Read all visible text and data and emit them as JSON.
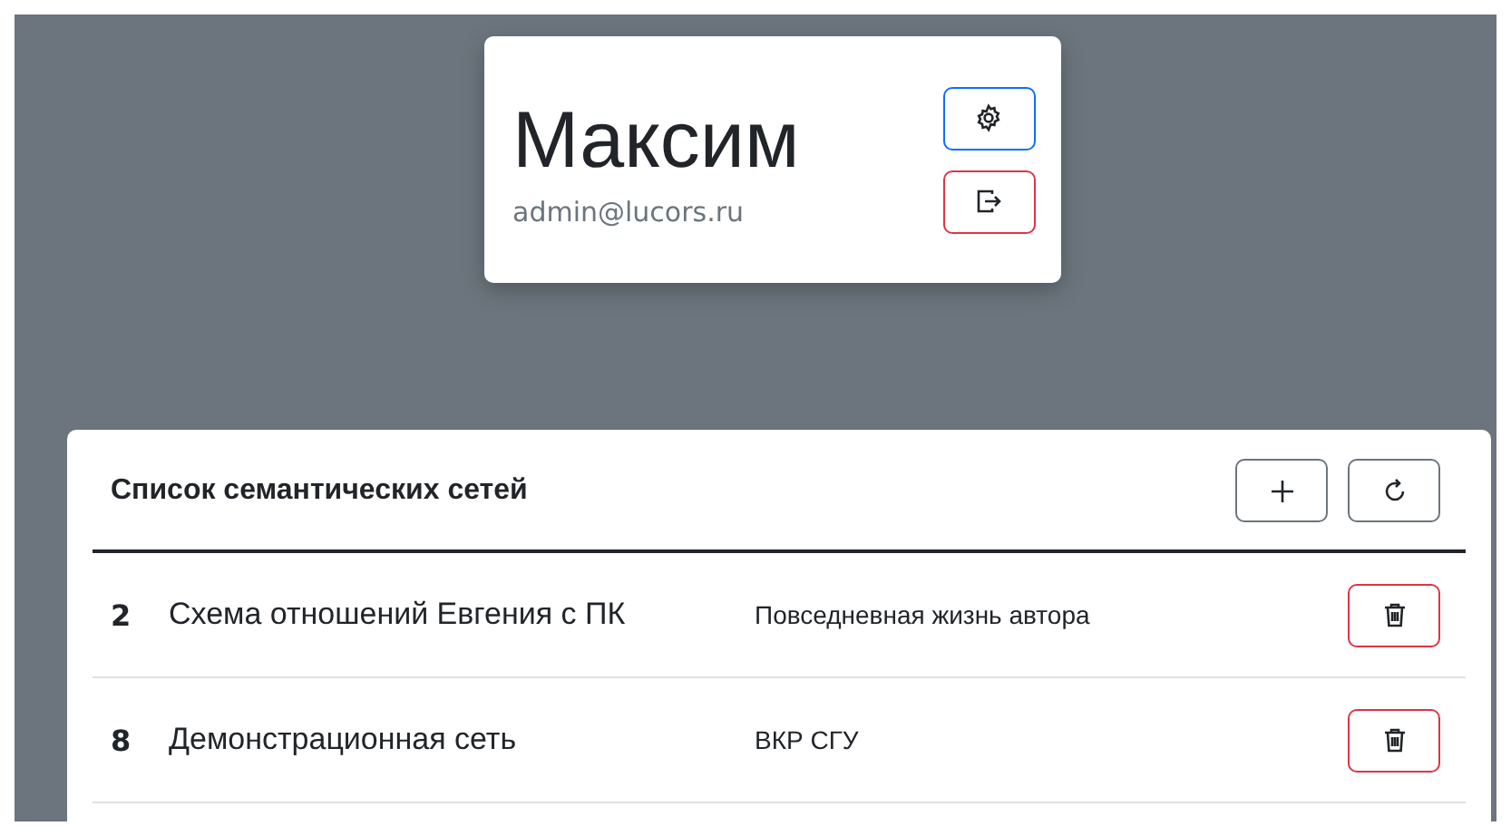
{
  "profile": {
    "name": "Максим",
    "email": "admin@lucors.ru"
  },
  "networks": {
    "title": "Список семантических сетей",
    "rows": [
      {
        "number": "2",
        "name": "Схема отношений Евгения с ПК",
        "description": "Повседневная жизнь автора"
      },
      {
        "number": "8",
        "name": "Демонстрационная сеть",
        "description": "ВКР СГУ"
      }
    ]
  }
}
